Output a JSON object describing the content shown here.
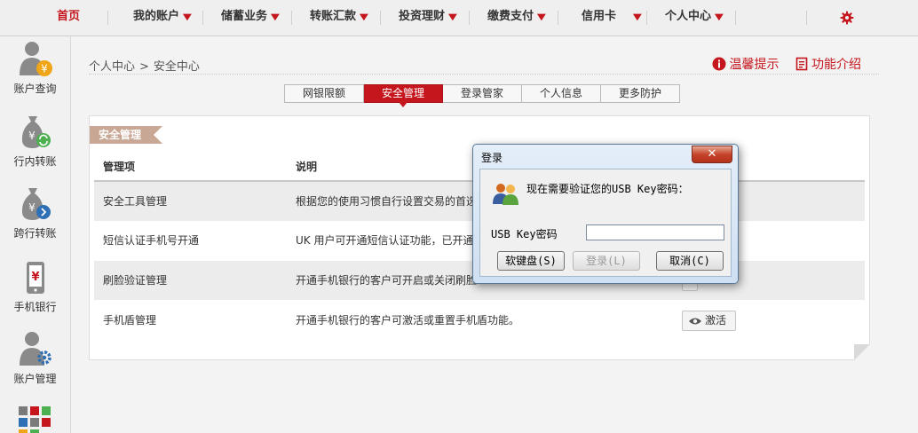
{
  "nav": {
    "items": [
      {
        "label": "首页",
        "has_menu": false,
        "active": true
      },
      {
        "label": "我的账户",
        "has_menu": true
      },
      {
        "label": "储蓄业务",
        "has_menu": true
      },
      {
        "label": "转账汇款",
        "has_menu": true
      },
      {
        "label": "投资理财",
        "has_menu": true
      },
      {
        "label": "缴费支付",
        "has_menu": true
      },
      {
        "label": "信用卡",
        "has_menu": true
      },
      {
        "label": "个人中心",
        "has_menu": true
      }
    ],
    "chevron": "▼",
    "settings_icon": "gear-icon",
    "accent": "#c4161c"
  },
  "sidebar": {
    "items": [
      {
        "label": "账户查询",
        "icon": "account-query-icon"
      },
      {
        "label": "行内转账",
        "icon": "intra-bank-transfer-icon"
      },
      {
        "label": "跨行转账",
        "icon": "inter-bank-transfer-icon"
      },
      {
        "label": "手机银行",
        "icon": "mobile-banking-icon"
      },
      {
        "label": "账户管理",
        "icon": "account-management-icon"
      }
    ]
  },
  "breadcrumb": {
    "parent": "个人中心",
    "sep": ">",
    "current": "安全中心"
  },
  "hints": {
    "tips": "温馨提示",
    "features": "功能介绍"
  },
  "subtabs": [
    {
      "label": "网银限额",
      "active": false
    },
    {
      "label": "安全管理",
      "active": true
    },
    {
      "label": "登录管家",
      "active": false
    },
    {
      "label": "个人信息",
      "active": false
    },
    {
      "label": "更多防护",
      "active": false
    }
  ],
  "panel": {
    "ribbon": "安全管理",
    "headers": {
      "item": "管理项",
      "desc": "说明"
    },
    "rows": [
      {
        "item": "安全工具管理",
        "desc": "根据您的使用习惯自行设置交易的首选"
      },
      {
        "item": "短信认证手机号开通",
        "desc": "UK 用户可开通短信认证功能，已开通"
      },
      {
        "item": "刷脸验证管理",
        "desc": "开通手机银行的客户可开启或关闭刷脸"
      },
      {
        "item": "手机盾管理",
        "desc": "开通手机银行的客户可激活或重置手机盾功能。",
        "action": "激活"
      }
    ]
  },
  "dialog": {
    "title": "登录",
    "close": "✕",
    "message": "现在需要验证您的USB Key密码：",
    "field_label": "USB Key密码",
    "field_value": "",
    "buttons": {
      "keyboard": "软键盘(S)",
      "login": "登录(L)",
      "cancel": "取消(C)"
    }
  }
}
